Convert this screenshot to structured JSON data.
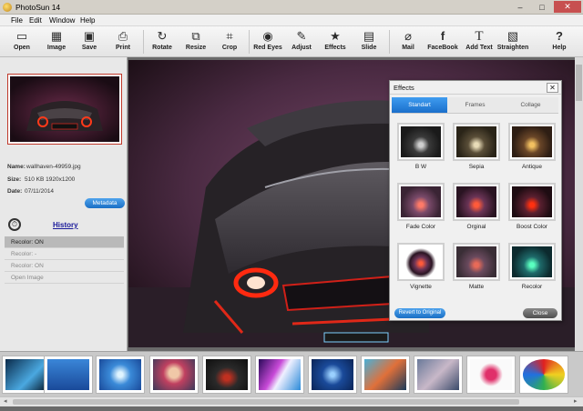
{
  "window": {
    "title": "PhotoSun 14",
    "minimize": "–",
    "maximize": "□",
    "close": "✕"
  },
  "menu": [
    "File",
    "Edit",
    "Window",
    "Help"
  ],
  "toolbar": [
    {
      "label": "Open",
      "icon": "▭"
    },
    {
      "label": "Image",
      "icon": "▦"
    },
    {
      "label": "Save",
      "icon": "▣"
    },
    {
      "label": "Print",
      "icon": "⎙"
    },
    {
      "label": "Rotate",
      "icon": "↻"
    },
    {
      "label": "Resize",
      "icon": "⧉"
    },
    {
      "label": "Crop",
      "icon": "⌗"
    },
    {
      "label": "Red Eyes",
      "icon": "◉"
    },
    {
      "label": "Adjust",
      "icon": "✎"
    },
    {
      "label": "Effects",
      "icon": "★"
    },
    {
      "label": "Slide",
      "icon": "▤"
    },
    {
      "label": "Mail",
      "icon": "⌀"
    },
    {
      "label": "FaceBook",
      "icon": "f"
    },
    {
      "label": "Add Text",
      "icon": "T"
    },
    {
      "label": "Straighten",
      "icon": "▧"
    },
    {
      "label": "Help",
      "icon": "?"
    }
  ],
  "info": {
    "name_label": "Name:",
    "name_value": "wallhaven-49959.jpg",
    "size_label": "Size:",
    "size_value": "510 KB  1920x1200",
    "date_label": "Date:",
    "date_value": "07/11/2014",
    "metadata_button": "Metadata"
  },
  "history": {
    "title": "History",
    "items": [
      "Recolor: ON",
      "Recolor: -",
      "Recolor: ON",
      "Open Image"
    ]
  },
  "effects": {
    "title": "Effects",
    "close": "✕",
    "tabs": [
      "Standart",
      "Frames",
      "Collage"
    ],
    "items": [
      "B W",
      "Sepia",
      "Antique",
      "Fade Color",
      "Orginal",
      "Boost Color",
      "Vignette",
      "Matte",
      "Recolor"
    ],
    "revert_button": "Revert to Original",
    "close_button": "Close"
  },
  "scroll": {
    "left": "◂",
    "right": "▸"
  },
  "colors": {
    "accent": "#1a6fc5",
    "accent_light": "#4fa3ec",
    "red_frame": "#c0392b"
  }
}
